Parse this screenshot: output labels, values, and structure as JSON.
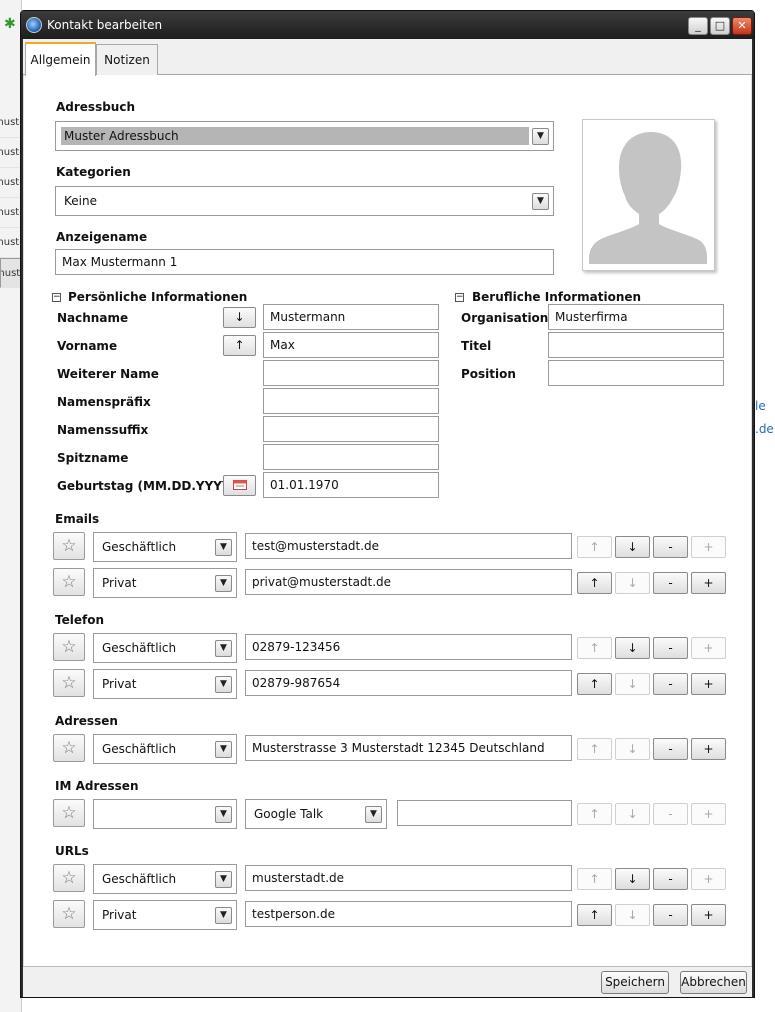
{
  "background": {
    "left_rows": [
      "muste",
      "muste",
      "muste",
      "muste",
      "muste",
      "muste"
    ],
    "right_links": [
      "le",
      ".de"
    ]
  },
  "window": {
    "title": "Kontakt bearbeiten",
    "controls": {
      "minimize": "_",
      "maximize": "□",
      "close": "✕"
    }
  },
  "tabs": [
    {
      "label": "Allgemein",
      "active": true
    },
    {
      "label": "Notizen",
      "active": false
    }
  ],
  "general": {
    "addressbook_label": "Adressbuch",
    "addressbook_value": "Muster Adressbuch",
    "categories_label": "Kategorien",
    "categories_value": "Keine",
    "displayname_label": "Anzeigename",
    "displayname_value": "Max Mustermann 1"
  },
  "personal": {
    "header": "Persönliche Informationen",
    "fields": [
      {
        "label": "Nachname",
        "value": "Mustermann",
        "button": "↓"
      },
      {
        "label": "Vorname",
        "value": "Max",
        "button": "↑"
      },
      {
        "label": "Weiterer Name",
        "value": ""
      },
      {
        "label": "Namenspräfix",
        "value": ""
      },
      {
        "label": "Namenssuffix",
        "value": ""
      },
      {
        "label": "Spitzname",
        "value": ""
      },
      {
        "label": "Geburtstag (MM.DD.YYYY)",
        "value": "01.01.1970",
        "button": "calendar-icon"
      }
    ]
  },
  "business": {
    "header": "Berufliche Informationen",
    "fields": [
      {
        "label": "Organisation",
        "value": "Musterfirma"
      },
      {
        "label": "Titel",
        "value": ""
      },
      {
        "label": "Position",
        "value": ""
      }
    ]
  },
  "emails": {
    "label": "Emails",
    "rows": [
      {
        "type": "Geschäftlich",
        "value": "test@musterstadt.de"
      },
      {
        "type": "Privat",
        "value": "privat@musterstadt.de"
      }
    ]
  },
  "phones": {
    "label": "Telefon",
    "rows": [
      {
        "type": "Geschäftlich",
        "value": "02879-123456"
      },
      {
        "type": "Privat",
        "value": "02879-987654"
      }
    ]
  },
  "addresses": {
    "label": "Adressen",
    "rows": [
      {
        "type": "Geschäftlich",
        "value": "Musterstrasse 3 Musterstadt 12345 Deutschland"
      }
    ]
  },
  "im": {
    "label": "IM Adressen",
    "rows": [
      {
        "type": "",
        "service": "Google Talk",
        "value": ""
      }
    ]
  },
  "urls": {
    "label": "URLs",
    "rows": [
      {
        "type": "Geschäftlich",
        "value": "musterstadt.de"
      },
      {
        "type": "Privat",
        "value": "testperson.de"
      }
    ]
  },
  "row_buttons": {
    "up": "↑",
    "down": "↓",
    "remove": "-",
    "add": "+"
  },
  "footer": {
    "save": "Speichern",
    "cancel": "Abbrechen"
  },
  "colors": {
    "active_tab_accent": "#f5a623",
    "titlebar": "#2c2c2c",
    "close_button": "#c4331b"
  }
}
